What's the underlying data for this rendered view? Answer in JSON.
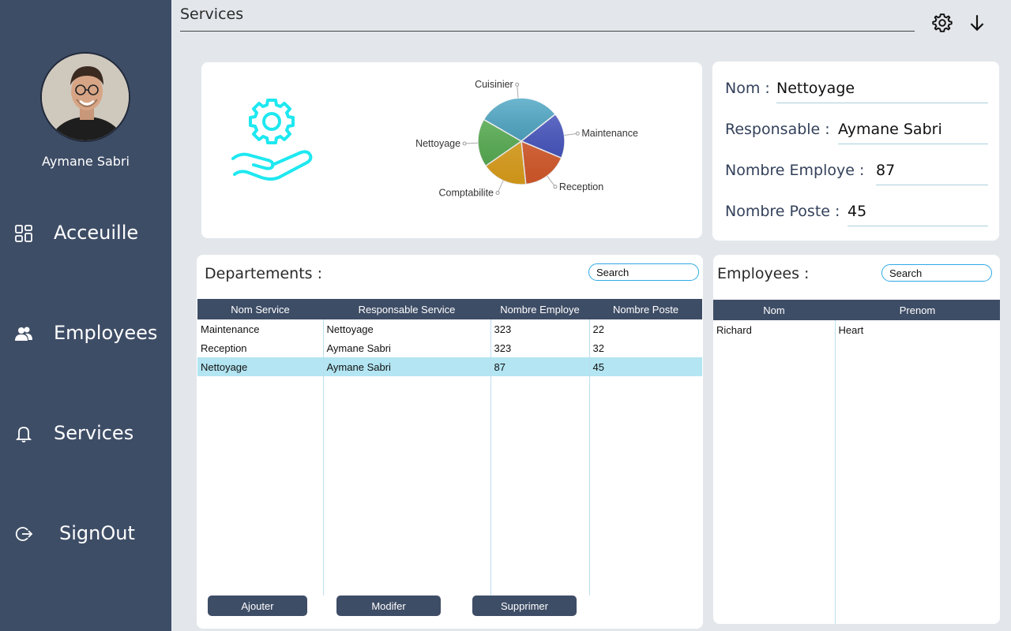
{
  "sidebar": {
    "user_name": "Aymane Sabri",
    "items": [
      {
        "label": "Acceuille",
        "icon": "grid-icon"
      },
      {
        "label": "Employees",
        "icon": "users-icon"
      },
      {
        "label": "Services",
        "icon": "bell-icon"
      },
      {
        "label": "SignOut",
        "icon": "signout-icon"
      }
    ]
  },
  "header": {
    "title": "Services",
    "icons": [
      "gear-icon",
      "download-arrow-icon"
    ]
  },
  "chart_data": {
    "type": "pie",
    "categories": [
      "Cuisinier",
      "Maintenance",
      "Reception",
      "Comptabilite",
      "Nettoyage"
    ],
    "values": [
      31,
      17,
      17,
      17,
      18
    ],
    "colors": [
      "#3d9ec0",
      "#3f4fc2",
      "#e25e2c",
      "#e9a81d",
      "#55b250"
    ],
    "title": ""
  },
  "details": {
    "nom_label": "Nom :",
    "nom_value": "Nettoyage",
    "responsable_label": "Responsable :",
    "responsable_value": "Aymane Sabri",
    "nb_employe_label": "Nombre Employe :",
    "nb_employe_value": "87",
    "nb_poste_label": "Nombre Poste :",
    "nb_poste_value": "45"
  },
  "departements": {
    "title": "Departements :",
    "search_placeholder": "Search",
    "columns": [
      "Nom Service",
      "Responsable Service",
      "Nombre Employe",
      "Nombre Poste"
    ],
    "rows": [
      [
        "Maintenance",
        "Nettoyage",
        "323",
        "22"
      ],
      [
        "Reception",
        "Aymane Sabri",
        "323",
        "32"
      ],
      [
        "Nettoyage",
        "Aymane Sabri",
        "87",
        "45"
      ]
    ],
    "selected_row": 2,
    "buttons": {
      "add": "Ajouter",
      "edit": "Modifer",
      "delete": "Supprimer"
    }
  },
  "employees": {
    "title": "Employees :",
    "search_placeholder": "Search",
    "columns": [
      "Nom",
      "Prenom"
    ],
    "rows": [
      [
        "Richard",
        "Heart"
      ]
    ]
  },
  "colors": {
    "sidebar": "#3e4d66",
    "header_row": "#3e4d66",
    "selected_row": "#b3e5f2",
    "search_border": "#2ea9e6",
    "service_icon": "#1ee8f0"
  }
}
